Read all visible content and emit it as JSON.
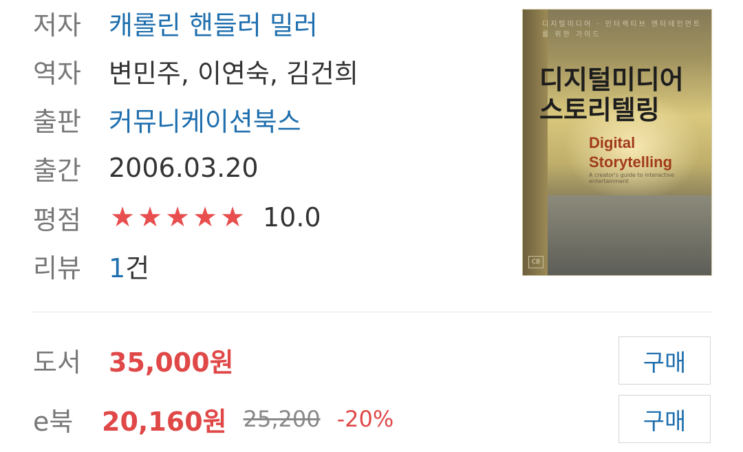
{
  "book": {
    "author_label": "저자",
    "author": "캐롤린 핸들러 밀러",
    "translator_label": "역자",
    "translators": "변민주, 이연숙, 김건희",
    "publisher_label": "출판",
    "publisher": "커뮤니케이션북스",
    "date_label": "출간",
    "date": "2006.03.20",
    "rating_label": "평점",
    "rating_stars": 5,
    "rating_value": "10.0",
    "review_label": "리뷰",
    "review_count": "1",
    "review_unit": "건"
  },
  "cover": {
    "top_text": "디지털미디어 · 인터랙티브 엔터테인먼트를 위한 가이드",
    "title_kr_line1": "디지털미디어",
    "title_kr_line2": "스토리텔링",
    "title_en_line1": "Digital",
    "title_en_line2": "Storytelling",
    "subtitle": "A creator's guide to interactive entertainment"
  },
  "pricing": {
    "print_label": "도서",
    "print_price": "35,000원",
    "print_buy": "구매",
    "ebook_label": "e북",
    "ebook_price": "20,160원",
    "ebook_original": "25,200",
    "ebook_discount": "-20%",
    "ebook_buy": "구매"
  },
  "colors": {
    "link": "#1f6fae",
    "price": "#e04848",
    "star": "#e84e4e"
  },
  "icons": {
    "star": "star-icon"
  }
}
